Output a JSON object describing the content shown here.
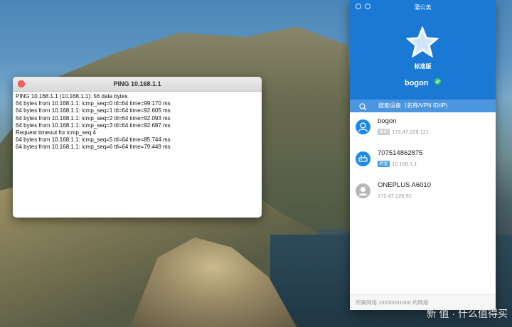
{
  "ping_window": {
    "title": "PING 10.168.1.1",
    "lines": [
      "PING 10.168.1.1 (10.168.1.1): 56 data bytes",
      "64 bytes from 10.168.1.1: icmp_seq=0 ttl=64 time=99.170 ms",
      "64 bytes from 10.168.1.1: icmp_seq=1 ttl=64 time=92.605 ms",
      "64 bytes from 10.168.1.1: icmp_seq=2 ttl=64 time=92.093 ms",
      "64 bytes from 10.168.1.1: icmp_seq=3 ttl=64 time=92.687 ms",
      "Request timeout for icmp_seq 4",
      "64 bytes from 10.168.1.1: icmp_seq=5 ttl=64 time=85.744 ms",
      "64 bytes from 10.168.1.1: icmp_seq=6 ttl=64 time=79.449 ms"
    ]
  },
  "app": {
    "title": "蒲公英",
    "edition": "标准版",
    "hostname": "bogon",
    "status_color": "#3fc96b",
    "accent_color": "#1b79d6",
    "search_placeholder": "搜索设备（名称/VPN ID/IP)",
    "devices": [
      {
        "name": "bogon",
        "tag": "本机",
        "ip": "172.47.226.121",
        "icon": "user-icon",
        "online": true
      },
      {
        "name": "707514862875",
        "tag": "转发",
        "ip": "10.168.1.1",
        "icon": "router-icon",
        "online": true
      },
      {
        "name": "ONEPLUS A6010",
        "tag": "",
        "ip": "172.47.226.92",
        "icon": "user-icon",
        "online": false
      }
    ],
    "footer": "所属网络 15200091660 的网络"
  },
  "watermark": "新 值 · 什么值得买"
}
